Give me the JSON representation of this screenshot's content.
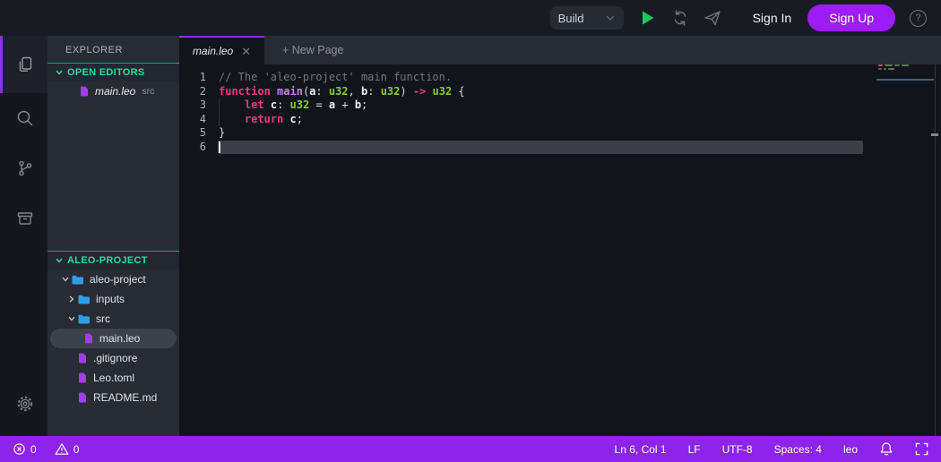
{
  "colors": {
    "accent_purple": "#9c1df7",
    "statusbar_purple": "#8e24ec",
    "accent_green": "#2cd9a2",
    "keyword": "#ef3b7d",
    "type": "#85cc30",
    "function": "#c47fe8",
    "comment": "#6e7681",
    "folder_blue": "#2e9fe6",
    "file_purple": "#a03df5",
    "play_green": "#22c55e"
  },
  "topbar": {
    "build_label": "Build",
    "sign_in_label": "Sign In",
    "sign_up_label": "Sign Up",
    "help_glyph": "?",
    "icons": [
      "chevron-down-icon",
      "play-icon",
      "sync-icon",
      "send-icon",
      "help-icon"
    ]
  },
  "activity_bar": {
    "items": [
      "files",
      "search",
      "source-control",
      "packages"
    ],
    "active_item": "files",
    "bottom_item": "settings"
  },
  "explorer": {
    "title": "EXPLORER",
    "open_editors": {
      "label": "OPEN EDITORS",
      "items": [
        {
          "name": "main.leo",
          "detail": "src"
        }
      ]
    },
    "project": {
      "label": "ALEO-PROJECT",
      "tree": [
        {
          "label": "aleo-project",
          "type": "folder",
          "state": "open",
          "depth": 0
        },
        {
          "label": "inputs",
          "type": "folder",
          "state": "closed",
          "depth": 1
        },
        {
          "label": "src",
          "type": "folder",
          "state": "open",
          "depth": 1
        },
        {
          "label": "main.leo",
          "type": "file",
          "depth": 2,
          "selected": true
        },
        {
          "label": ".gitignore",
          "type": "file",
          "depth": 1
        },
        {
          "label": "Leo.toml",
          "type": "file",
          "depth": 1
        },
        {
          "label": "README.md",
          "type": "file",
          "depth": 1
        }
      ]
    }
  },
  "editor": {
    "tab_label": "main.leo",
    "tab_close_glyph": "✕",
    "new_page_label": "+ New Page",
    "active_line": 6,
    "lines": [
      {
        "num": 1,
        "tokens": [
          {
            "t": "// The 'aleo-project' main function.",
            "c": "cm"
          }
        ]
      },
      {
        "num": 2,
        "tokens": [
          {
            "t": "function",
            "c": "kw"
          },
          {
            "t": " ",
            "c": "pl"
          },
          {
            "t": "main",
            "c": "fn"
          },
          {
            "t": "(",
            "c": "pl"
          },
          {
            "t": "a",
            "c": "id"
          },
          {
            "t": ": ",
            "c": "pl"
          },
          {
            "t": "u32",
            "c": "ty"
          },
          {
            "t": ", ",
            "c": "pl"
          },
          {
            "t": "b",
            "c": "id"
          },
          {
            "t": ": ",
            "c": "pl"
          },
          {
            "t": "u32",
            "c": "ty"
          },
          {
            "t": ") ",
            "c": "pl"
          },
          {
            "t": "->",
            "c": "kw"
          },
          {
            "t": " ",
            "c": "pl"
          },
          {
            "t": "u32",
            "c": "ty"
          },
          {
            "t": " {",
            "c": "pl"
          }
        ]
      },
      {
        "num": 3,
        "tokens": [
          {
            "t": "    ",
            "c": "pl"
          },
          {
            "t": "let",
            "c": "kw"
          },
          {
            "t": " ",
            "c": "pl"
          },
          {
            "t": "c",
            "c": "id"
          },
          {
            "t": ": ",
            "c": "pl"
          },
          {
            "t": "u32",
            "c": "ty"
          },
          {
            "t": " = ",
            "c": "pl"
          },
          {
            "t": "a",
            "c": "id"
          },
          {
            "t": " + ",
            "c": "pl"
          },
          {
            "t": "b",
            "c": "id"
          },
          {
            "t": ";",
            "c": "pl"
          }
        ]
      },
      {
        "num": 4,
        "tokens": [
          {
            "t": "    ",
            "c": "pl"
          },
          {
            "t": "return",
            "c": "kw"
          },
          {
            "t": " ",
            "c": "pl"
          },
          {
            "t": "c",
            "c": "id"
          },
          {
            "t": ";",
            "c": "pl"
          }
        ]
      },
      {
        "num": 5,
        "tokens": [
          {
            "t": "}",
            "c": "pl"
          }
        ]
      },
      {
        "num": 6,
        "tokens": []
      }
    ]
  },
  "status_bar": {
    "errors": "0",
    "warnings": "0",
    "cursor_position": "Ln 6, Col 1",
    "eol": "LF",
    "encoding": "UTF-8",
    "indentation": "Spaces: 4",
    "language": "leo",
    "icons": [
      "error-icon",
      "warning-icon",
      "bell-icon",
      "fullscreen-icon"
    ]
  }
}
